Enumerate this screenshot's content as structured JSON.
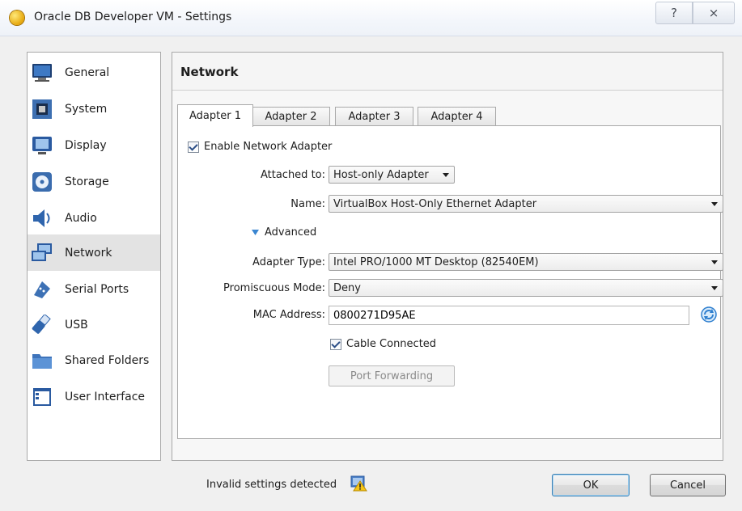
{
  "window": {
    "title": "Oracle DB Developer VM - Settings",
    "help_glyph": "?",
    "close_glyph": "⨯"
  },
  "sidebar": {
    "items": [
      {
        "label": "General",
        "icon": "general-icon"
      },
      {
        "label": "System",
        "icon": "system-icon"
      },
      {
        "label": "Display",
        "icon": "display-icon"
      },
      {
        "label": "Storage",
        "icon": "storage-icon"
      },
      {
        "label": "Audio",
        "icon": "audio-icon"
      },
      {
        "label": "Network",
        "icon": "network-icon",
        "selected": true
      },
      {
        "label": "Serial Ports",
        "icon": "serial-ports-icon"
      },
      {
        "label": "USB",
        "icon": "usb-icon"
      },
      {
        "label": "Shared Folders",
        "icon": "shared-folders-icon"
      },
      {
        "label": "User Interface",
        "icon": "user-interface-icon"
      }
    ]
  },
  "main": {
    "title": "Network",
    "tabs": [
      {
        "label": "Adapter 1",
        "active": true
      },
      {
        "label": "Adapter 2"
      },
      {
        "label": "Adapter 3"
      },
      {
        "label": "Adapter 4"
      }
    ],
    "enable_adapter": {
      "label": "Enable Network Adapter",
      "checked": true
    },
    "attached_to": {
      "label": "Attached to:",
      "value": "Host-only Adapter"
    },
    "name": {
      "label": "Name:",
      "value": "VirtualBox Host-Only Ethernet Adapter"
    },
    "advanced": {
      "label": "Advanced"
    },
    "adapter_type": {
      "label": "Adapter Type:",
      "value": "Intel PRO/1000 MT Desktop (82540EM)"
    },
    "promiscuous": {
      "label": "Promiscuous Mode:",
      "value": "Deny"
    },
    "mac": {
      "label": "MAC Address:",
      "value": "0800271D95AE"
    },
    "cable": {
      "label": "Cable Connected",
      "checked": true
    },
    "port_forwarding": {
      "label": "Port Forwarding"
    }
  },
  "footer": {
    "status": "Invalid settings detected",
    "ok": "OK",
    "cancel": "Cancel"
  },
  "colors": {
    "selected_bg": "#e3e3e3",
    "ok_border": "#3c7fb1",
    "advanced_arrow": "#3a86d1"
  }
}
